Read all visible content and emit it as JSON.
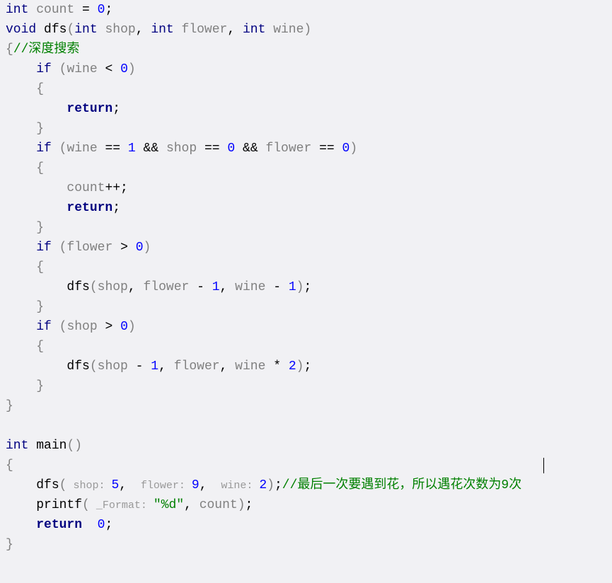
{
  "lines": {
    "l1": {
      "type": "int",
      "sp1": " ",
      "ident": "count",
      "sp2": " ",
      "op": "=",
      "sp3": " ",
      "num": "0",
      "semi": ";"
    },
    "l2": {
      "type": "void",
      "sp1": " ",
      "func": "dfs",
      "lp": "(",
      "t1": "int",
      "sp2": " ",
      "p1": "shop",
      "comma1": ",",
      "sp3": " ",
      "t2": "int",
      "sp4": " ",
      "p2": "flower",
      "comma2": ",",
      "sp5": " ",
      "t3": "int",
      "sp6": " ",
      "p3": "wine",
      "rp": ")"
    },
    "l3": {
      "brace": "{",
      "comment": "//深度搜索"
    },
    "l4": {
      "indent": "    ",
      "kw": "if",
      "sp1": " ",
      "lp": "(",
      "ident": "wine",
      "sp2": " ",
      "op": "<",
      "sp3": " ",
      "num": "0",
      "rp": ")"
    },
    "l5": {
      "indent": "    ",
      "brace": "{"
    },
    "l6": {
      "indent": "        ",
      "kw": "return",
      "semi": ";"
    },
    "l7": {
      "indent": "    ",
      "brace": "}"
    },
    "l8": {
      "indent": "    ",
      "kw": "if",
      "sp1": " ",
      "lp": "(",
      "i1": "wine",
      "sp2": " ",
      "op1": "==",
      "sp3": " ",
      "n1": "1",
      "sp4": " ",
      "op2": "&&",
      "sp5": " ",
      "i2": "shop",
      "sp6": " ",
      "op3": "==",
      "sp7": " ",
      "n2": "0",
      "sp8": " ",
      "op4": "&&",
      "sp9": " ",
      "i3": "flower",
      "sp10": " ",
      "op5": "==",
      "sp11": " ",
      "n3": "0",
      "rp": ")"
    },
    "l9": {
      "indent": "    ",
      "brace": "{"
    },
    "l10": {
      "indent": "        ",
      "ident": "count",
      "op": "++",
      "semi": ";"
    },
    "l11": {
      "indent": "        ",
      "kw": "return",
      "semi": ";"
    },
    "l12": {
      "indent": "    ",
      "brace": "}"
    },
    "l13": {
      "indent": "    ",
      "kw": "if",
      "sp1": " ",
      "lp": "(",
      "ident": "flower",
      "sp2": " ",
      "op": ">",
      "sp3": " ",
      "num": "0",
      "rp": ")"
    },
    "l14": {
      "indent": "    ",
      "brace": "{"
    },
    "l15": {
      "indent": "        ",
      "func": "dfs",
      "lp": "(",
      "a1": "shop",
      "c1": ",",
      "sp1": " ",
      "a2": "flower",
      "sp2": " ",
      "op1": "-",
      "sp3": " ",
      "n1": "1",
      "c2": ",",
      "sp4": " ",
      "a3": "wine",
      "sp5": " ",
      "op2": "-",
      "sp6": " ",
      "n2": "1",
      "rp": ")",
      "semi": ";"
    },
    "l16": {
      "indent": "    ",
      "brace": "}"
    },
    "l17": {
      "indent": "    ",
      "kw": "if",
      "sp1": " ",
      "lp": "(",
      "ident": "shop",
      "sp2": " ",
      "op": ">",
      "sp3": " ",
      "num": "0",
      "rp": ")"
    },
    "l18": {
      "indent": "    ",
      "brace": "{"
    },
    "l19": {
      "indent": "        ",
      "func": "dfs",
      "lp": "(",
      "a1": "shop",
      "sp1": " ",
      "op1": "-",
      "sp2": " ",
      "n1": "1",
      "c1": ",",
      "sp3": " ",
      "a2": "flower",
      "c2": ",",
      "sp4": " ",
      "a3": "wine",
      "sp5": " ",
      "op2": "*",
      "sp6": " ",
      "n2": "2",
      "rp": ")",
      "semi": ";"
    },
    "l20": {
      "indent": "    ",
      "brace": "}"
    },
    "l21": {
      "brace": "}"
    },
    "l22": {
      "blank": " "
    },
    "l23": {
      "type": "int",
      "sp1": " ",
      "func": "main",
      "lp": "(",
      "rp": ")"
    },
    "l24": {
      "brace": "{"
    },
    "l25": {
      "indent": "    ",
      "func": "dfs",
      "lp": "(",
      "h1": " shop: ",
      "n1": "5",
      "c1": ",",
      "sp1": " ",
      "h2": " flower: ",
      "n2": "9",
      "c2": ",",
      "sp2": " ",
      "h3": " wine: ",
      "n3": "2",
      "rp": ")",
      "semi": ";",
      "comment": "//最后一次要遇到花，所以遇花次数为9次"
    },
    "l26": {
      "indent": "    ",
      "func": "printf",
      "lp": "(",
      "h1": " _Format: ",
      "str": "\"%d\"",
      "c1": ",",
      "sp1": " ",
      "ident": "count",
      "rp": ")",
      "semi": ";"
    },
    "l27": {
      "indent": "    ",
      "kw": "return",
      "sp1": "  ",
      "num": "0",
      "semi": ";"
    },
    "l28": {
      "brace": "}"
    }
  },
  "colors": {
    "background": "#f1f1f4",
    "keyword": "#000080",
    "identifier": "#808080",
    "number": "#0000FF",
    "comment": "#008000",
    "string": "#008000"
  }
}
